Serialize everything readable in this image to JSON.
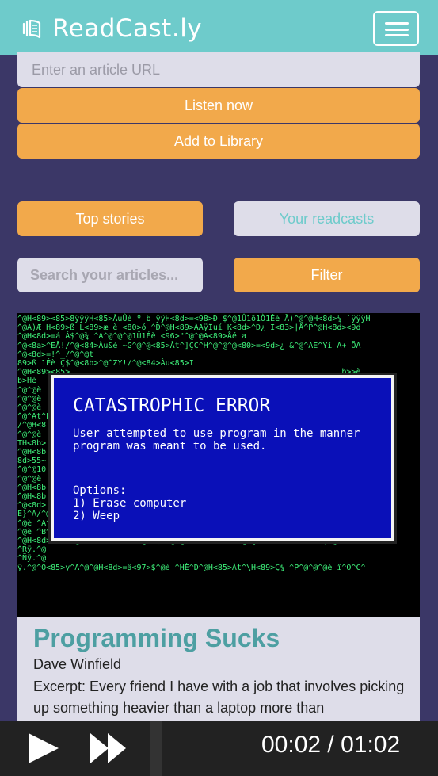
{
  "header": {
    "brand_name": "ReadCast.ly",
    "brand_icon": "book-soundwave-icon",
    "menu_icon": "hamburger-menu-icon"
  },
  "url_form": {
    "placeholder": "Enter an article URL",
    "listen_label": "Listen now",
    "library_label": "Add to Library"
  },
  "tabs": {
    "top_stories": "Top stories",
    "your_readcasts": "Your readcasts"
  },
  "search": {
    "placeholder": "Search your articles...",
    "filter_label": "Filter"
  },
  "article": {
    "image": {
      "error_title": "CATASTROPHIC ERROR",
      "error_message": "User attempted to use program in the manner\nprogram was meant to be used.",
      "options": "Options:\n1) Erase computer\n2) Weep"
    },
    "title": "Programming Sucks",
    "author": "Dave Winfield",
    "excerpt": "Excerpt: Every friend I have with a job that involves picking up something heavier than a laptop more than"
  },
  "player": {
    "time": "00:02 / 01:02",
    "play_icon": "play-icon",
    "forward_icon": "fast-forward-icon"
  },
  "colors": {
    "header_bg": "#6ecbcb",
    "page_bg": "#3b3767",
    "accent_orange": "#f2a94b",
    "title_teal": "#4d9fa2",
    "error_blue": "#0a10b8",
    "matrix_green": "#3ef07a"
  }
}
